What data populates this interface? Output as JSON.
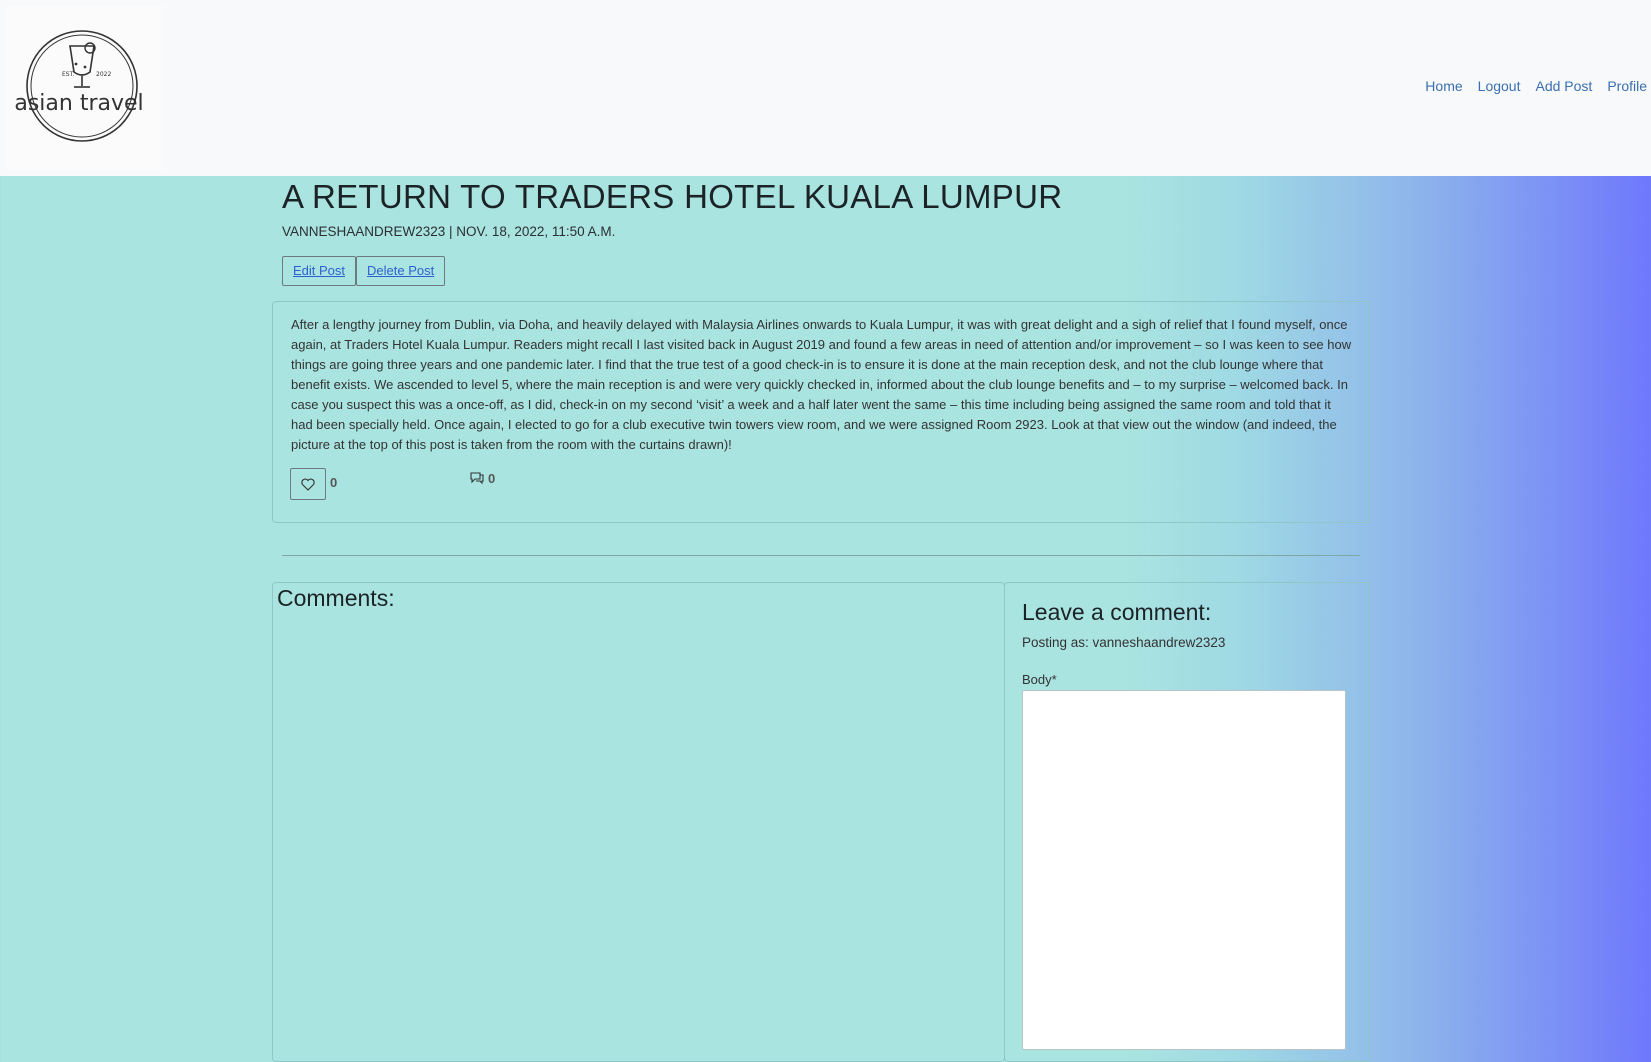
{
  "logo": {
    "text": "asian travel",
    "est_left": "EST.",
    "est_right": "2022"
  },
  "nav": {
    "links": [
      "Home",
      "Logout",
      "Add Post",
      "Profile"
    ]
  },
  "post": {
    "title": "A RETURN TO TRADERS HOTEL KUALA LUMPUR",
    "meta": "VANNESHAANDREW2323 | NOV. 18, 2022, 11:50 A.M.",
    "edit_label": "Edit Post",
    "delete_label": "Delete Post",
    "body": "After a lengthy journey from Dublin, via Doha, and heavily delayed with Malaysia Airlines onwards to Kuala Lumpur, it was with great delight and a sigh of relief that I found myself, once again, at Traders Hotel Kuala Lumpur. Readers might recall I last visited back in August 2019 and found a few areas in need of attention and/or improvement – so I was keen to see how things are going three years and one pandemic later. I find that the true test of a good check-in is to ensure it is done at the main reception desk, and not the club lounge where that benefit exists. We ascended to level 5, where the main reception is and were very quickly checked in, informed about the club lounge benefits and – to my surprise – welcomed back. In case you suspect this was a once-off, as I did, check-in on my second ‘visit’ a week and a half later went the same – this time including being assigned the same room and told that it had been specially held. Once again, I elected to go for a club executive twin towers view room, and we were assigned Room 2923. Look at that view out the window (and indeed, the picture at the top of this post is taken from the room with the curtains drawn)!",
    "likes": "0",
    "comments_count": "0",
    "like_icon": "heart-icon",
    "comment_icon": "chat-icon"
  },
  "comments": {
    "heading": "Comments:"
  },
  "leave_comment": {
    "heading": "Leave a comment:",
    "posting_as": "Posting as: vanneshaandrew2323",
    "body_label": "Body*",
    "body_value": ""
  }
}
